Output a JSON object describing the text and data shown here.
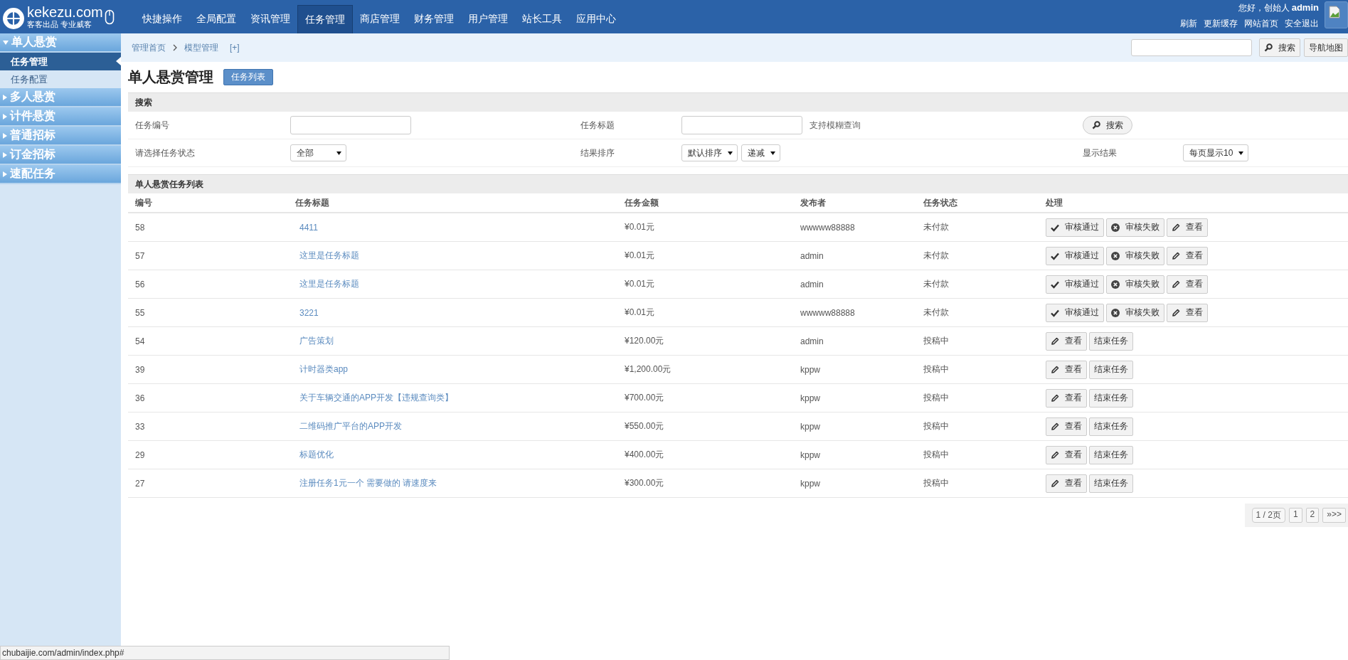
{
  "logo": {
    "title": "kekezu.com",
    "slogan": "客客出品 专业威客"
  },
  "nav": [
    {
      "label": "快捷操作",
      "selected": false
    },
    {
      "label": "全局配置",
      "selected": false
    },
    {
      "label": "资讯管理",
      "selected": false
    },
    {
      "label": "任务管理",
      "selected": true
    },
    {
      "label": "商店管理",
      "selected": false
    },
    {
      "label": "财务管理",
      "selected": false
    },
    {
      "label": "用户管理",
      "selected": false
    },
    {
      "label": "站长工具",
      "selected": false
    },
    {
      "label": "应用中心",
      "selected": false
    }
  ],
  "user": {
    "greeting": "您好，创始人",
    "name": "admin",
    "links": [
      "刷新",
      "更新缓存",
      "网站首页",
      "安全退出"
    ]
  },
  "sidebar": [
    {
      "label": "单人悬赏",
      "expanded": true,
      "children": [
        {
          "label": "任务管理",
          "selected": true
        },
        {
          "label": "任务配置",
          "selected": false
        }
      ]
    },
    {
      "label": "多人悬赏",
      "expanded": false
    },
    {
      "label": "计件悬赏",
      "expanded": false
    },
    {
      "label": "普通招标",
      "expanded": false
    },
    {
      "label": "订金招标",
      "expanded": false
    },
    {
      "label": "速配任务",
      "expanded": false
    }
  ],
  "breadcrumb": [
    "管理首页",
    "模型管理"
  ],
  "breadcrumb_add": "[+]",
  "top_search": {
    "button": "搜索",
    "sitemap": "导航地图"
  },
  "page_title": "单人悬赏管理",
  "page_tab": "任务列表",
  "search": {
    "title": "搜索",
    "id_label": "任务编号",
    "title_label": "任务标题",
    "hint": "支持模糊查询",
    "button": "搜索",
    "status_label": "请选择任务状态",
    "status_value": "全部",
    "sort_label": "结果排序",
    "sort_value": "默认排序",
    "order_value": "递减",
    "show_label": "显示结果",
    "show_value": "每页显示10"
  },
  "table": {
    "title": "单人悬赏任务列表",
    "columns": [
      "编号",
      "任务标题",
      "任务金额",
      "发布者",
      "任务状态",
      "处理"
    ],
    "rows": [
      {
        "id": "58",
        "title": "4411",
        "amount": "¥0.01元",
        "author": "wwwww88888",
        "status": "未付款",
        "actions": [
          {
            "label": "审核通过",
            "kind": "approve"
          },
          {
            "label": "审核失败",
            "kind": "reject"
          },
          {
            "label": "查看",
            "kind": "view"
          }
        ]
      },
      {
        "id": "57",
        "title": "这里是任务标题",
        "amount": "¥0.01元",
        "author": "admin",
        "status": "未付款",
        "actions": [
          {
            "label": "审核通过",
            "kind": "approve"
          },
          {
            "label": "审核失败",
            "kind": "reject"
          },
          {
            "label": "查看",
            "kind": "view"
          }
        ]
      },
      {
        "id": "56",
        "title": "这里是任务标题",
        "amount": "¥0.01元",
        "author": "admin",
        "status": "未付款",
        "actions": [
          {
            "label": "审核通过",
            "kind": "approve"
          },
          {
            "label": "审核失败",
            "kind": "reject"
          },
          {
            "label": "查看",
            "kind": "view"
          }
        ]
      },
      {
        "id": "55",
        "title": "3221",
        "amount": "¥0.01元",
        "author": "wwwww88888",
        "status": "未付款",
        "actions": [
          {
            "label": "审核通过",
            "kind": "approve"
          },
          {
            "label": "审核失败",
            "kind": "reject"
          },
          {
            "label": "查看",
            "kind": "view"
          }
        ]
      },
      {
        "id": "54",
        "title": "广告策划",
        "amount": "¥120.00元",
        "author": "admin",
        "status": "投稿中",
        "actions": [
          {
            "label": "查看",
            "kind": "view"
          },
          {
            "label": "结束任务",
            "kind": "end"
          }
        ]
      },
      {
        "id": "39",
        "title": "计时器类app",
        "amount": "¥1,200.00元",
        "author": "kppw",
        "status": "投稿中",
        "actions": [
          {
            "label": "查看",
            "kind": "view"
          },
          {
            "label": "结束任务",
            "kind": "end"
          }
        ]
      },
      {
        "id": "36",
        "title": "关于车辆交通的APP开发【违规查询类】",
        "amount": "¥700.00元",
        "author": "kppw",
        "status": "投稿中",
        "actions": [
          {
            "label": "查看",
            "kind": "view"
          },
          {
            "label": "结束任务",
            "kind": "end"
          }
        ]
      },
      {
        "id": "33",
        "title": "二维码推广平台的APP开发",
        "amount": "¥550.00元",
        "author": "kppw",
        "status": "投稿中",
        "actions": [
          {
            "label": "查看",
            "kind": "view"
          },
          {
            "label": "结束任务",
            "kind": "end"
          }
        ]
      },
      {
        "id": "29",
        "title": "标题优化",
        "amount": "¥400.00元",
        "author": "kppw",
        "status": "投稿中",
        "actions": [
          {
            "label": "查看",
            "kind": "view"
          },
          {
            "label": "结束任务",
            "kind": "end"
          }
        ]
      },
      {
        "id": "27",
        "title": "注册任务1元一个 需要做的 请速度来",
        "amount": "¥300.00元",
        "author": "kppw",
        "status": "投稿中",
        "actions": [
          {
            "label": "查看",
            "kind": "view"
          },
          {
            "label": "结束任务",
            "kind": "end"
          }
        ]
      }
    ]
  },
  "pagination": {
    "info": "1 / 2页",
    "pages": [
      "1",
      "2"
    ],
    "next": "»>>"
  },
  "status_bar": "chubaijie.com/admin/index.php#"
}
